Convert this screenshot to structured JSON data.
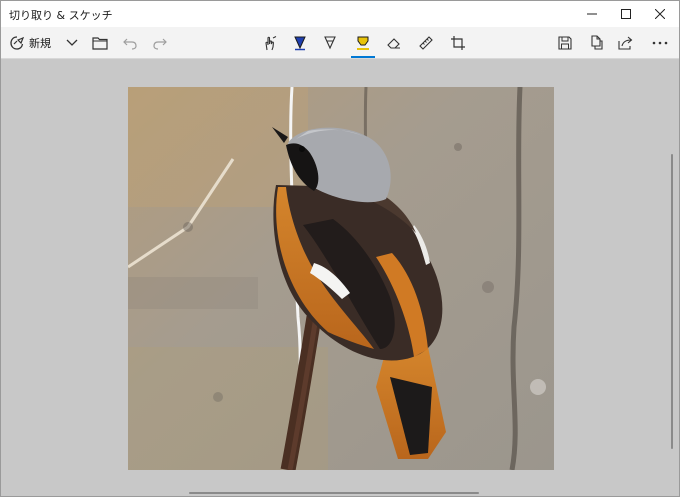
{
  "window": {
    "title": "切り取り & スケッチ"
  },
  "toolbar": {
    "new_label": "新規",
    "icons": {
      "new": "new-snip-icon",
      "dropdown": "chevron-down-icon",
      "open": "folder-icon",
      "undo": "undo-icon",
      "redo": "redo-icon",
      "touch": "touch-writing-icon",
      "ballpoint": "ballpoint-pen-icon",
      "pencil": "pencil-icon",
      "highlighter": "highlighter-icon",
      "eraser": "eraser-icon",
      "ruler": "ruler-icon",
      "crop": "crop-icon",
      "save": "save-icon",
      "copy": "copy-icon",
      "share": "share-icon",
      "more": "more-icon"
    },
    "active_tool": "highlighter",
    "colors": {
      "ballpoint": "#1f3fb0",
      "highlighter": "#e8c30a",
      "accent": "#0078d4"
    }
  },
  "canvas": {
    "image_subject": "robin-bird-photo"
  }
}
